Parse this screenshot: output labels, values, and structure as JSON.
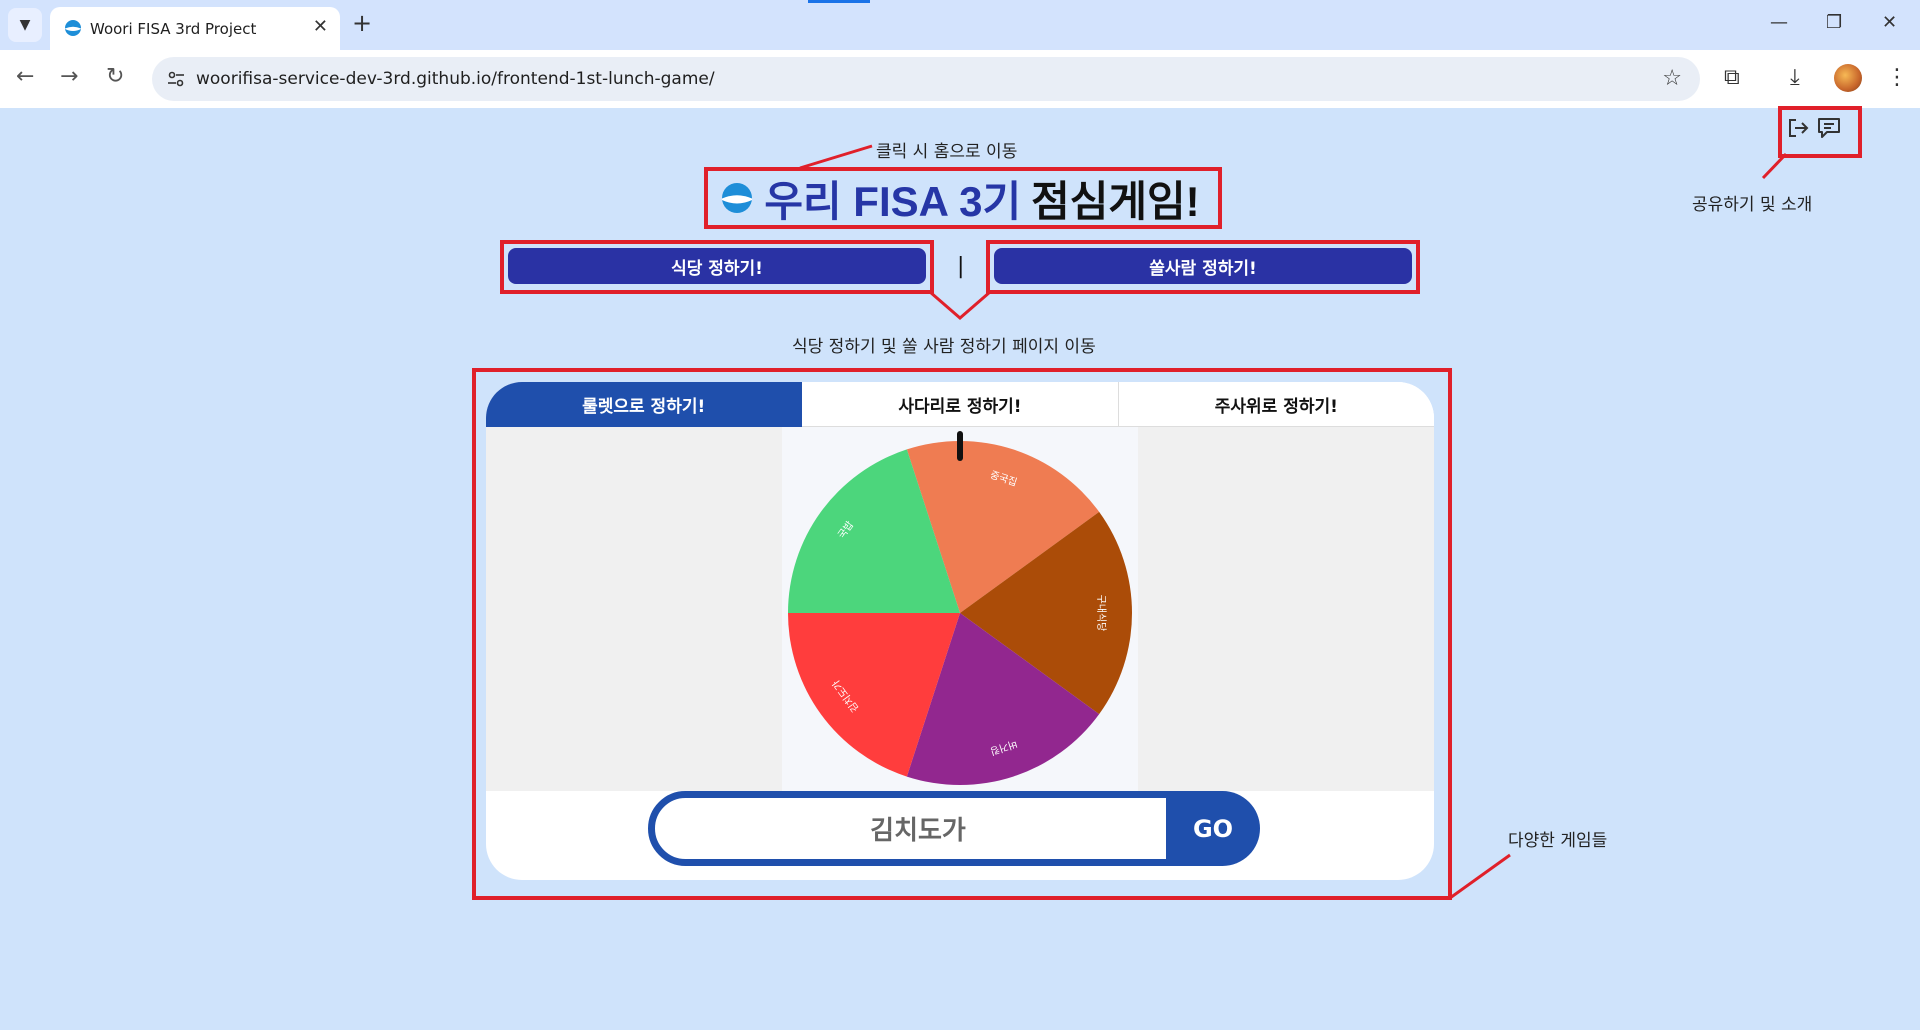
{
  "browser": {
    "tab_title": "Woori FISA 3rd Project",
    "url": "woorifisa-service-dev-3rd.github.io/frontend-1st-lunch-game/"
  },
  "header": {
    "title_blue": "우리 FISA 3기",
    "title_black": "점심게임!"
  },
  "nav": {
    "restaurant_label": "식당 정하기!",
    "payer_label": "쏠사람 정하기!",
    "divider": "|"
  },
  "game": {
    "tabs": [
      {
        "label": "룰렛으로 정하기!",
        "active": true
      },
      {
        "label": "사다리로 정하기!",
        "active": false
      },
      {
        "label": "주사위로 정하기!",
        "active": false
      }
    ],
    "roulette": {
      "segments": [
        {
          "label": "중국집",
          "color": "#ef7c52"
        },
        {
          "label": "구내식당",
          "color": "#ab4c08"
        },
        {
          "label": "버거킹",
          "color": "#92278f"
        },
        {
          "label": "김치도가",
          "color": "#ff3d3d"
        },
        {
          "label": "국밥",
          "color": "#4cd67c"
        }
      ]
    },
    "result_value": "김치도가",
    "go_label": "GO"
  },
  "annotations": {
    "home_click": "클릭 시 홈으로 이동",
    "share_intro": "공유하기 및 소개",
    "page_move": "식당 정하기 및 쏠 사람 정하기 페이지 이동",
    "various_games": "다양한 게임들"
  },
  "colors": {
    "page_bg": "#cfe3fb",
    "primary": "#2a32a4",
    "accent": "#1f4fac",
    "annotation_red": "#e0202a"
  }
}
